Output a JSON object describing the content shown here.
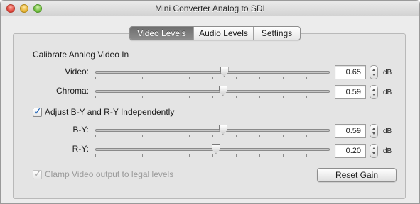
{
  "window": {
    "title": "Mini Converter Analog to SDI"
  },
  "tabs": [
    {
      "label": "Video Levels",
      "active": true
    },
    {
      "label": "Audio Levels",
      "active": false
    },
    {
      "label": "Settings",
      "active": false
    }
  ],
  "video_section": {
    "title": "Calibrate Analog Video In",
    "video": {
      "label": "Video:",
      "value": "0.65",
      "unit": "dB",
      "level": 0.55
    },
    "chroma": {
      "label": "Chroma:",
      "value": "0.59",
      "unit": "dB",
      "level": 0.545
    }
  },
  "independent": {
    "label": "Adjust B-Y and R-Y Independently",
    "checked": true,
    "by": {
      "label": "B-Y:",
      "value": "0.59",
      "unit": "dB",
      "level": 0.545
    },
    "ry": {
      "label": "R-Y:",
      "value": "0.20",
      "unit": "dB",
      "level": 0.515
    }
  },
  "clamp": {
    "label": "Clamp Video output to legal levels",
    "checked": true,
    "enabled": false
  },
  "reset_button": {
    "label": "Reset Gain"
  },
  "colors": {
    "active_tab": "#7a7a7a",
    "checkmark": "#1a5fb4"
  },
  "icons": {
    "stepper": "stepper-arrows-icon",
    "checkmark": "checkmark-icon"
  }
}
